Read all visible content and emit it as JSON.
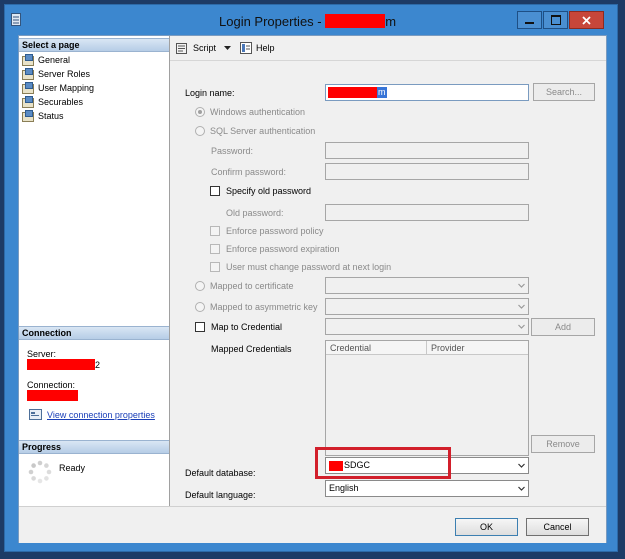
{
  "window": {
    "title_prefix": "Login Properties - ",
    "title_suffix": "m"
  },
  "toolbar": {
    "script_label": "Script",
    "help_label": "Help"
  },
  "left_panel": {
    "select_page_header": "Select a page",
    "pages": [
      "General",
      "Server Roles",
      "User Mapping",
      "Securables",
      "Status"
    ],
    "connection_header": "Connection",
    "server_label": "Server:",
    "server_suffix": "2",
    "connection_label": "Connection:",
    "view_connection_link": "View connection properties",
    "progress_header": "Progress",
    "progress_status": "Ready"
  },
  "form": {
    "login_name_label": "Login name:",
    "login_name_suffix": "m",
    "search_button": "Search...",
    "windows_auth": "Windows authentication",
    "sql_auth": "SQL Server authentication",
    "password_label": "Password:",
    "confirm_password_label": "Confirm password:",
    "specify_old_password": "Specify old password",
    "old_password_label": "Old password:",
    "enforce_policy": "Enforce password policy",
    "enforce_expiration": "Enforce password expiration",
    "must_change": "User must change password at next login",
    "mapped_cert": "Mapped to certificate",
    "mapped_asym": "Mapped to asymmetric key",
    "map_credential": "Map to Credential",
    "add_button": "Add",
    "mapped_credentials_label": "Mapped Credentials",
    "credential_col": "Credential",
    "provider_col": "Provider",
    "remove_button": "Remove",
    "default_database_label": "Default database:",
    "default_database_value": "SDGC",
    "default_language_label": "Default language:",
    "default_language_value": "English"
  },
  "buttons": {
    "ok": "OK",
    "cancel": "Cancel"
  },
  "colors": {
    "accent": "#3c87cf",
    "redaction": "#ff0000",
    "highlight": "#d21f2b",
    "link": "#1a3fb8"
  }
}
